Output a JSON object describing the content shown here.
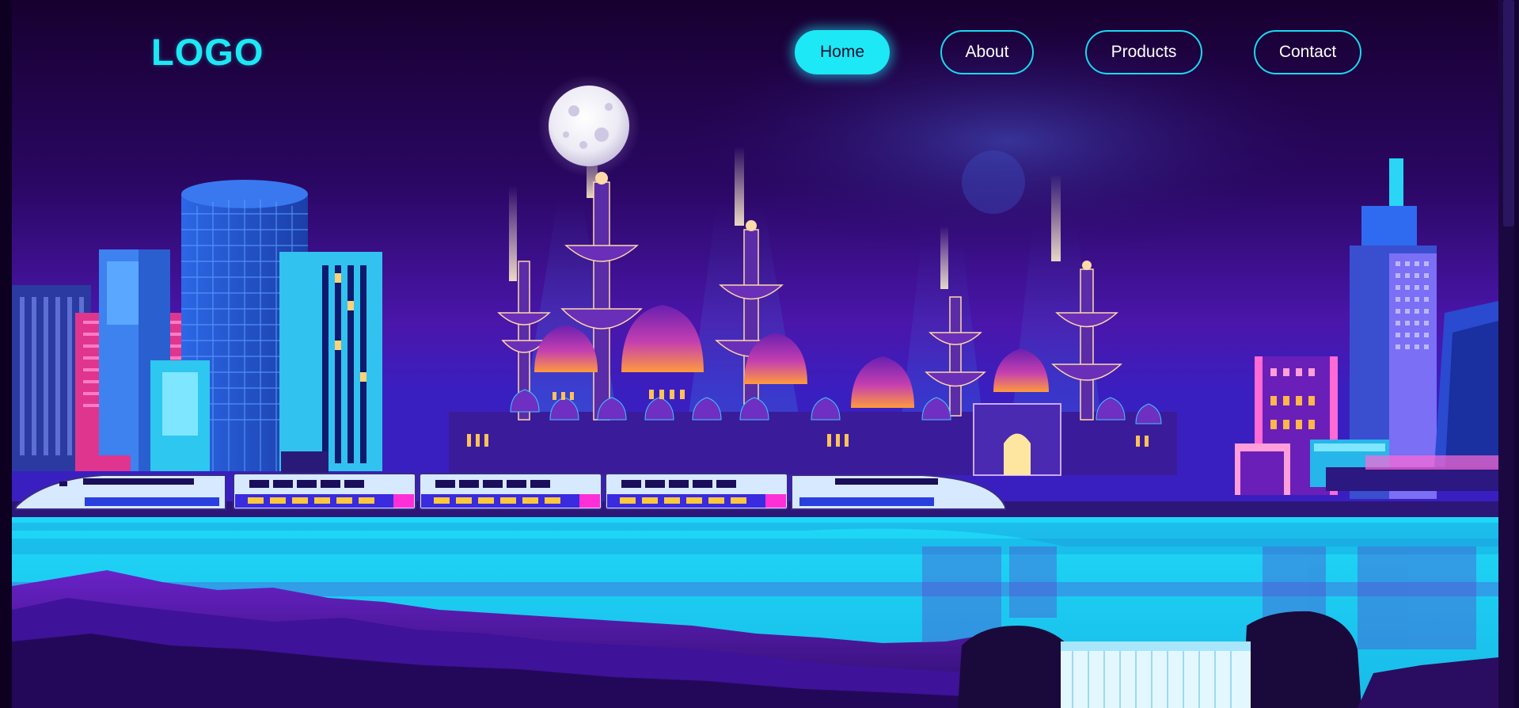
{
  "header": {
    "logo_text": "LOGO",
    "nav": [
      {
        "label": "Home",
        "active": true
      },
      {
        "label": "About",
        "active": false
      },
      {
        "label": "Products",
        "active": false
      },
      {
        "label": "Contact",
        "active": false
      }
    ]
  },
  "colors": {
    "accent": "#1de8f5",
    "background": "#16002e",
    "water": "#1bd2f2",
    "sky_top": "#16002e",
    "sky_bottom": "#4a10a8"
  },
  "hero": {
    "illustration": "neon-city-night-skyline-with-mosque-moon-train"
  }
}
